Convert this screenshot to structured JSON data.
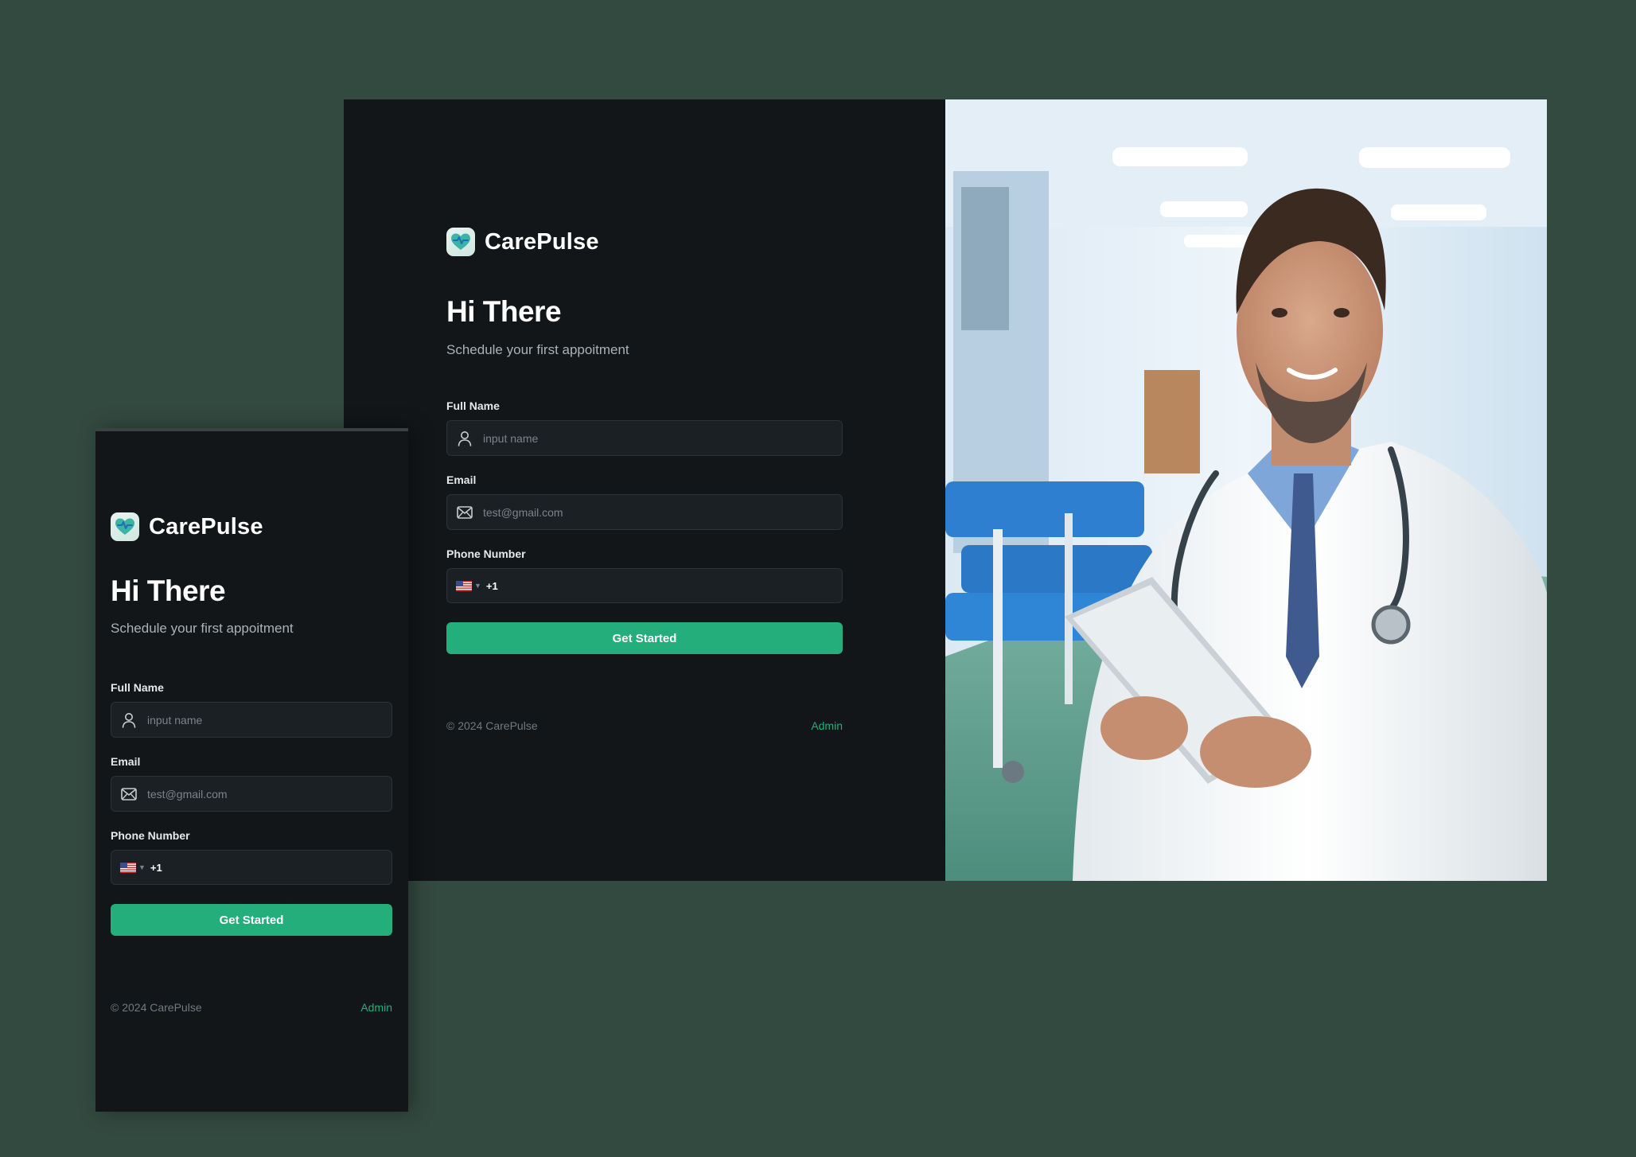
{
  "brand": {
    "name": "CarePulse",
    "accent": "#24ae7c",
    "background": "#334a40",
    "panel": "#121619"
  },
  "form": {
    "greeting": "Hi There",
    "subtitle": "Schedule your first appoitment",
    "full_name": {
      "label": "Full Name",
      "placeholder": "input name",
      "icon": "user-icon"
    },
    "email": {
      "label": "Email",
      "placeholder": "test@gmail.com",
      "icon": "mail-icon"
    },
    "phone": {
      "label": "Phone Number",
      "country": "US",
      "country_code": "+1",
      "icon": "us-flag-icon"
    },
    "submit_label": "Get Started"
  },
  "footer": {
    "copyright": "© 2024 CarePulse",
    "admin_label": "Admin"
  },
  "hero": {
    "subject": "smiling doctor in white coat with stethoscope holding a tablet in a hospital ward"
  }
}
